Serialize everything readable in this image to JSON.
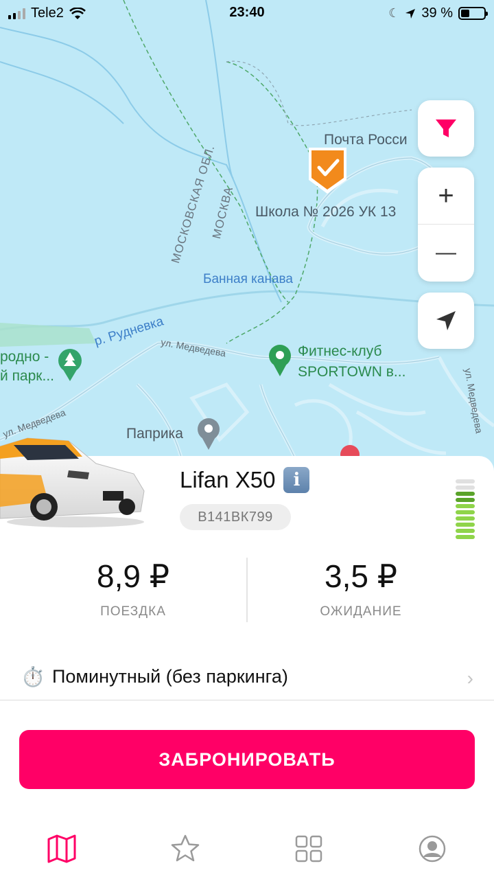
{
  "status_bar": {
    "carrier": "Tele2",
    "time": "23:40",
    "battery": "39 %",
    "battery_level": 0.39
  },
  "map": {
    "labels": {
      "post": "Почта Росси",
      "school": "Школа № 2026 УК 13",
      "region": "МОСКОВСКАЯ ОБЛ.",
      "city": "МОСКВА",
      "canal": "Банная канава",
      "river": "р. Рудневка",
      "street_top": "ул. Медведева",
      "street_left": "ул. Медведева",
      "street_right": "ул. Медведева",
      "park_1": "родно -",
      "park_2": "й парк...",
      "fitness_1": "Фитнес-клуб",
      "fitness_2": "SPORTOWN в...",
      "paprika": "Паприка"
    },
    "controls": {
      "zoom_in": "+",
      "zoom_out": "—"
    }
  },
  "car": {
    "name": "Lifan X50",
    "info": "i",
    "plate": "В141ВК799",
    "fuel_level": 0.8
  },
  "prices": {
    "trip_value": "8,9 ₽",
    "trip_label": "ПОЕЗДКА",
    "wait_value": "3,5 ₽",
    "wait_label": "ОЖИДАНИЕ"
  },
  "tariff": {
    "icon": "⏱️",
    "label": "Поминутный (без паркинга)",
    "chevron": "›"
  },
  "book_button": "ЗАБРОНИРОВАТЬ",
  "tabs": [
    "map-icon",
    "star-icon",
    "grid-icon",
    "profile-icon"
  ],
  "colors": {
    "accent": "#ff0066",
    "map_water": "#bfe9f7",
    "fuel_on": "#7bbf2a",
    "marker": "#f28a1c"
  }
}
